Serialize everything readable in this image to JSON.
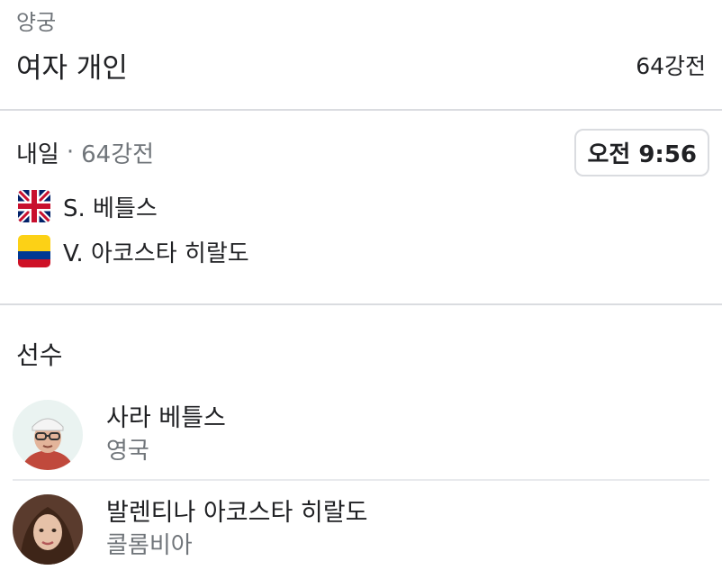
{
  "header": {
    "sport": "양궁",
    "event": "여자 개인",
    "round": "64강전"
  },
  "match": {
    "day": "내일",
    "separator": "·",
    "round": "64강전",
    "time": "오전 9:56",
    "competitors": [
      {
        "name": "S. 베틀스",
        "flag_icon": "uk-flag-icon"
      },
      {
        "name": "V. 아코스타 히랄도",
        "flag_icon": "colombia-flag-icon"
      }
    ]
  },
  "players": {
    "title": "선수",
    "items": [
      {
        "name": "사라 베틀스",
        "country": "영국",
        "avatar_icon": "athlete-photo-icon"
      },
      {
        "name": "발렌티나 아코스타 히랄도",
        "country": "콜롬비아",
        "avatar_icon": "athlete-photo-icon"
      }
    ]
  },
  "colors": {
    "text_primary": "#202124",
    "text_secondary": "#70757a",
    "divider": "#dadce0",
    "uk_blue": "#012169",
    "uk_red": "#C8102E",
    "colombia_yellow": "#FCD116",
    "colombia_blue": "#003893",
    "colombia_red": "#CE1126"
  }
}
